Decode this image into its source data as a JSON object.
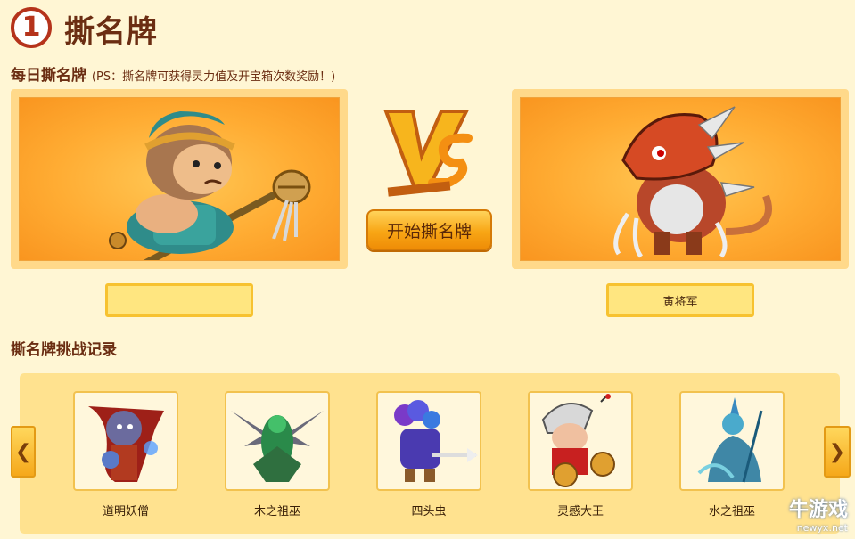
{
  "header": {
    "step_number": "1",
    "title": "撕名牌"
  },
  "daily": {
    "title": "每日撕名牌",
    "note": "(PS：撕名牌可获得灵力值及开宝箱次数奖励！)",
    "vs_text": "VS",
    "start_button": "开始撕名牌",
    "left_name": "",
    "right_name": "寅将军"
  },
  "records": {
    "title": "撕名牌挑战记录",
    "prev_arrow": "❮",
    "next_arrow": "❯",
    "items": [
      {
        "name": "道明妖僧"
      },
      {
        "name": "木之祖巫"
      },
      {
        "name": "四头虫"
      },
      {
        "name": "灵感大王"
      },
      {
        "name": "水之祖巫"
      }
    ]
  },
  "watermark": {
    "text": "牛游戏",
    "url": "newyx.net"
  }
}
